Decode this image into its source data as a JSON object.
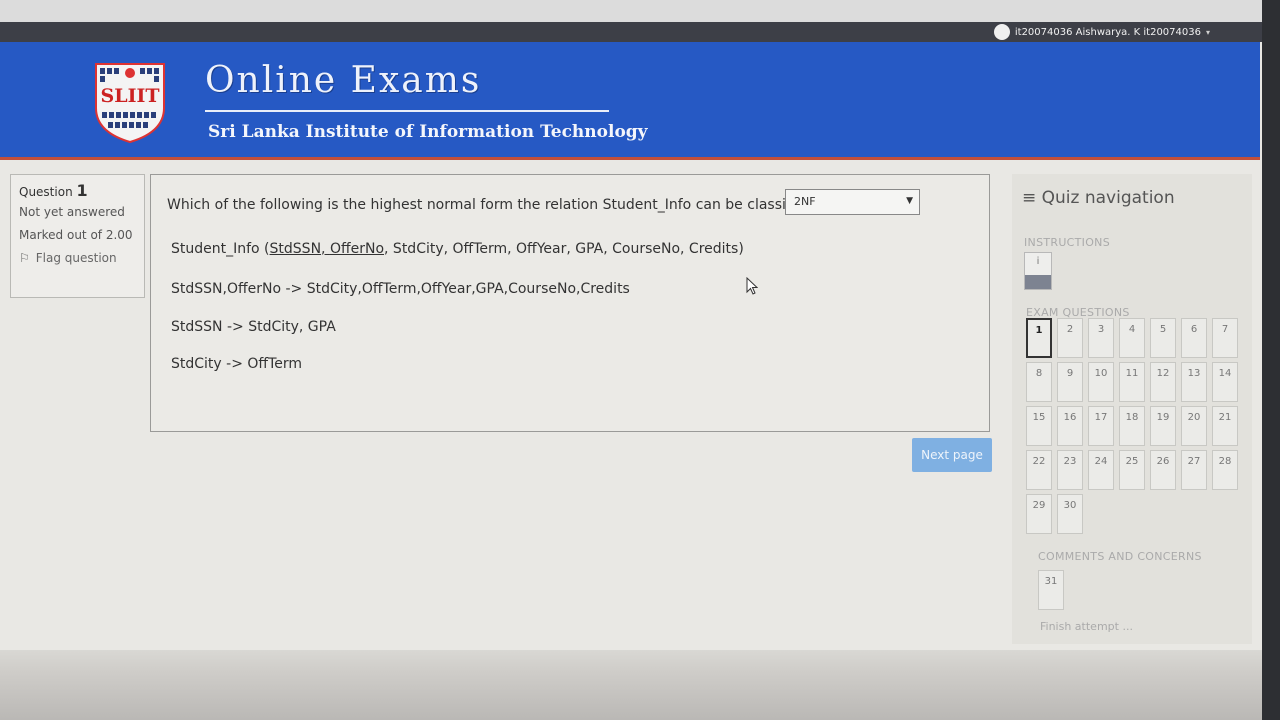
{
  "header": {
    "user_name": "it20074036 Aishwarya. K it20074036",
    "title": "Online Exams",
    "subtitle": "Sri Lanka Institute of Information Technology",
    "logo_text": "SLIIT"
  },
  "question_info": {
    "label": "Question",
    "number": "1",
    "status": "Not yet answered",
    "marks": "Marked out of 2.00",
    "flag_label": "Flag question"
  },
  "question": {
    "text": "Which of the following is the highest normal form the relation Student_Info can be classified?",
    "selected_answer": "2NF",
    "relation_prefix": "Student_Info (",
    "key_1": "StdSSN",
    "key_sep": ", ",
    "key_2": "OfferNo",
    "relation_rest": ", StdCity, OffTerm, OffYear, GPA, CourseNo, Credits)",
    "fd_1": "StdSSN,OfferNo -> StdCity,OffTerm,OffYear,GPA,CourseNo,Credits",
    "fd_2": "StdSSN -> StdCity, GPA",
    "fd_3": "StdCity -> OffTerm"
  },
  "next_button": "Next page",
  "quiz_nav": {
    "title": "Quiz navigation",
    "instructions_label": "INSTRUCTIONS",
    "instructions_button": "i",
    "exam_questions_label": "EXAM QUESTIONS",
    "questions": [
      "1",
      "2",
      "3",
      "4",
      "5",
      "6",
      "7",
      "8",
      "9",
      "10",
      "11",
      "12",
      "13",
      "14",
      "15",
      "16",
      "17",
      "18",
      "19",
      "20",
      "21",
      "22",
      "23",
      "24",
      "25",
      "26",
      "27",
      "28",
      "29",
      "30"
    ],
    "current_question": "1",
    "comments_label": "COMMENTS AND CONCERNS",
    "comments_question": "31",
    "finish_label": "Finish attempt ..."
  }
}
